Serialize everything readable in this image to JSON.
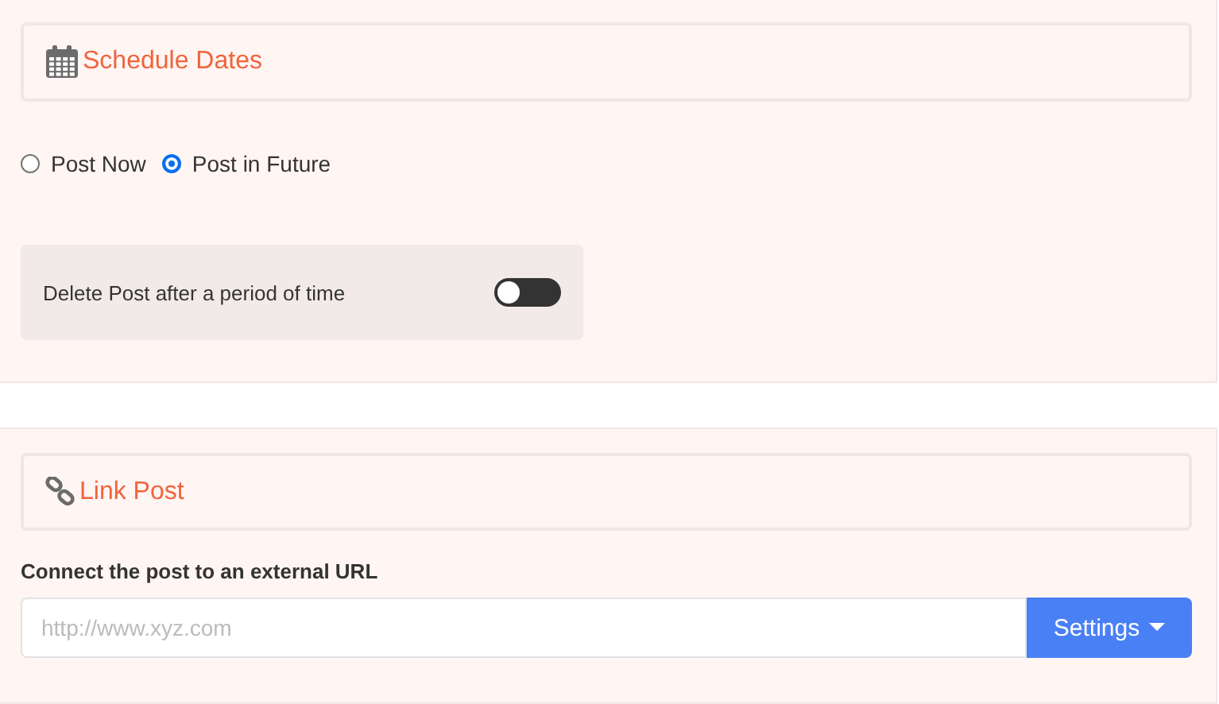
{
  "schedule": {
    "title": "Schedule Dates",
    "options": [
      {
        "label": "Post Now",
        "selected": false
      },
      {
        "label": "Post in Future",
        "selected": true
      }
    ],
    "delete_after": {
      "label": "Delete Post after a period of time",
      "on": false
    }
  },
  "link": {
    "title": "Link Post",
    "label": "Connect the post to an external URL",
    "placeholder": "http://www.xyz.com",
    "button": "Settings"
  }
}
